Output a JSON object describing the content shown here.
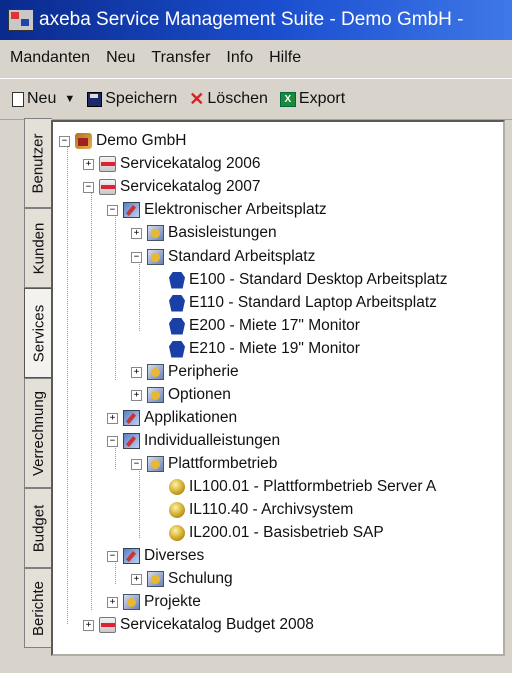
{
  "window": {
    "title": "axeba Service Management Suite - Demo GmbH -"
  },
  "menu": [
    "Mandanten",
    "Neu",
    "Transfer",
    "Info",
    "Hilfe"
  ],
  "toolbar": {
    "new_label": "Neu",
    "save_label": "Speichern",
    "delete_label": "Löschen",
    "export_label": "Export"
  },
  "tabs": [
    "Benutzer",
    "Kunden",
    "Services",
    "Verrechnung",
    "Budget",
    "Berichte"
  ],
  "active_tab": "Services",
  "tree": {
    "root": "Demo GmbH",
    "catalog_2006": "Servicekatalog 2006",
    "catalog_2007": "Servicekatalog 2007",
    "elektronischer_arbeitsplatz": "Elektronischer Arbeitsplatz",
    "basisleistungen": "Basisleistungen",
    "standard_arbeitsplatz": "Standard Arbeitsplatz",
    "e100": "E100 - Standard Desktop Arbeitsplatz",
    "e110": "E110 - Standard Laptop Arbeitsplatz",
    "e200": "E200 - Miete 17\" Monitor",
    "e210": "E210 - Miete 19\" Monitor",
    "peripherie": "Peripherie",
    "optionen": "Optionen",
    "applikationen": "Applikationen",
    "individualleistungen": "Individualleistungen",
    "plattformbetrieb": "Plattformbetrieb",
    "il100": "IL100.01 - Plattformbetrieb Server A",
    "il110": "IL110.40 - Archivsystem",
    "il200": "IL200.01 - Basisbetrieb SAP",
    "diverses": "Diverses",
    "schulung": "Schulung",
    "projekte": "Projekte",
    "catalog_budget_2008": "Servicekatalog Budget 2008"
  },
  "icons": {
    "root": "company-icon",
    "catalog": "catalog-icon",
    "category": "category-icon",
    "group": "service-group-icon",
    "service": "shield-icon",
    "individual_service": "gold-service-icon"
  },
  "colors": {
    "title_bar": "#0a2a8c",
    "service_icon": "#1a3fa6",
    "delete_icon": "#e02020"
  }
}
